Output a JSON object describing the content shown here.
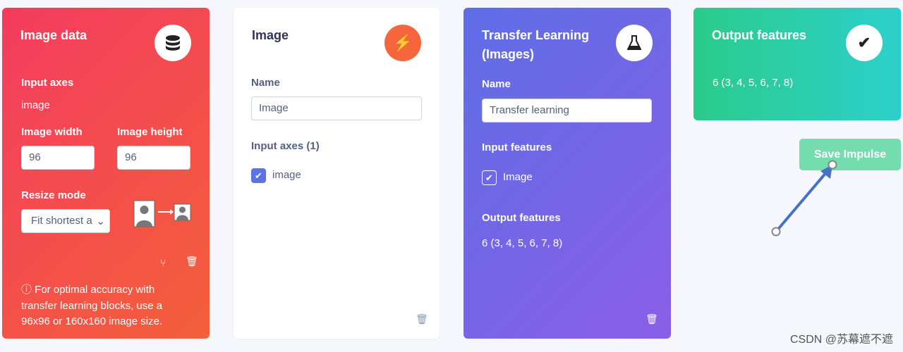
{
  "image_data": {
    "title": "Image data",
    "icon": "database-icon",
    "input_axes_label": "Input axes",
    "input_axes_value": "image",
    "width_label": "Image width",
    "width_value": "96",
    "height_label": "Image height",
    "height_value": "96",
    "resize_label": "Resize mode",
    "resize_value": "Fit shortest axis",
    "resize_display": "Fit shortest a",
    "note": "For optimal accuracy with transfer learning blocks, use a 96x96 or 160x160 image size."
  },
  "image_block": {
    "title": "Image",
    "icon": "bolt-icon",
    "name_label": "Name",
    "name_value": "Image",
    "axes_label": "Input axes (1)",
    "axis_item": "image"
  },
  "transfer": {
    "title": "Transfer Learning (Images)",
    "icon": "flask-icon",
    "name_label": "Name",
    "name_value": "Transfer learning",
    "input_label": "Input features",
    "input_item": "Image",
    "output_label": "Output features",
    "output_value": "6 (3, 4, 5, 6, 7, 8)"
  },
  "output": {
    "title": "Output features",
    "icon": "check-icon",
    "value": "6 (3, 4, 5, 6, 7, 8)"
  },
  "save_label": "Save Impulse",
  "watermark": "CSDN @苏幕遮不遮"
}
